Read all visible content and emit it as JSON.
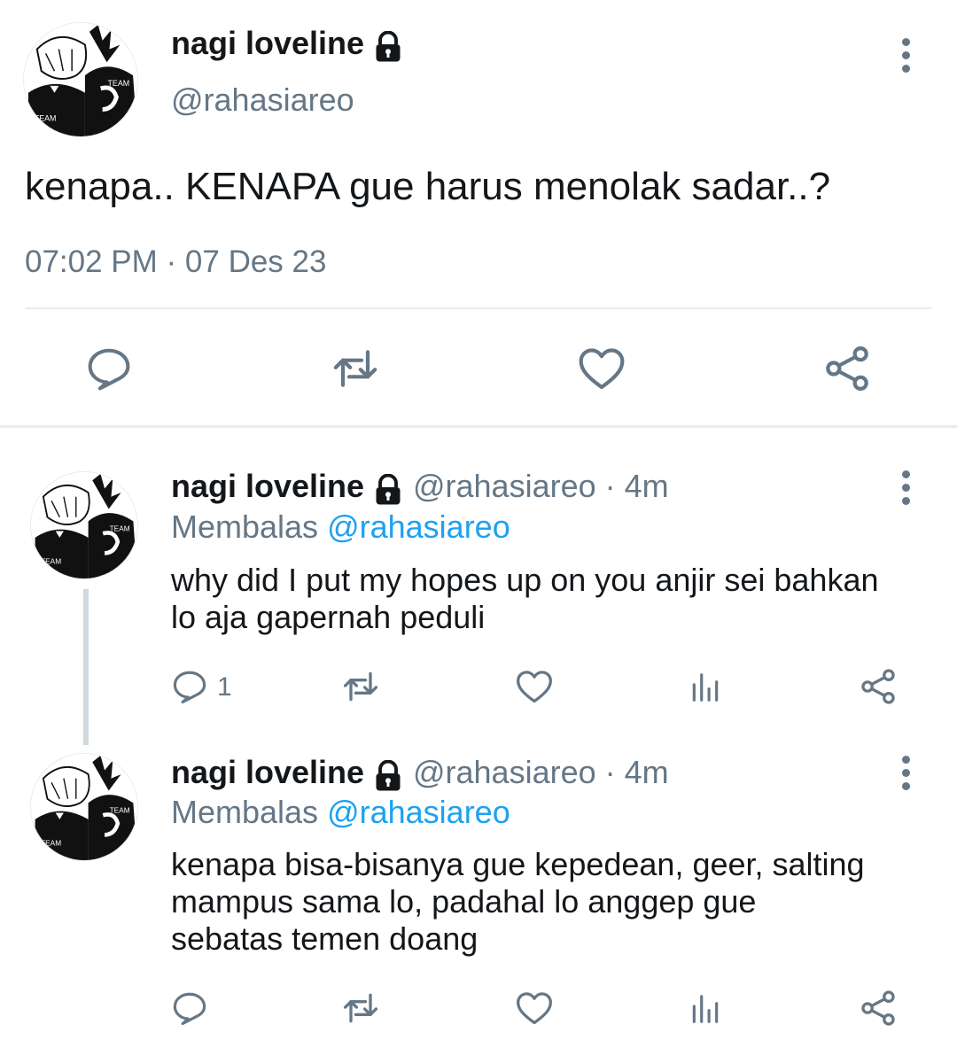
{
  "main_tweet": {
    "display_name": "nagi loveline",
    "handle": "@rahasiareo",
    "text": "kenapa.. KENAPA gue harus menolak sadar..?",
    "timestamp": "07:02 PM · 07 Des 23",
    "actions": [
      "reply-icon",
      "retweet-icon",
      "like-icon",
      "share-icon"
    ]
  },
  "replies": [
    {
      "display_name": "nagi loveline",
      "handle_time": "@rahasiareo · 4m",
      "reply_prefix": "Membalas",
      "reply_to": "@rahasiareo",
      "line1": "why did I put my hopes up on you anjir sei bahkan",
      "line2": "lo aja gapernah peduli",
      "reply_count": "1"
    },
    {
      "display_name": "nagi loveline",
      "handle_time": "@rahasiareo · 4m",
      "reply_prefix": "Membalas",
      "reply_to": "@rahasiareo",
      "line1": "kenapa bisa-bisanya gue kepedean, geer, salting",
      "line2": "mampus sama lo, padahal lo anggep gue",
      "line3": "sebatas temen doang"
    }
  ],
  "colors": {
    "text": "#14171a",
    "secondary": "#657786",
    "link": "#1da1f2",
    "divider": "#e6ecf0"
  }
}
